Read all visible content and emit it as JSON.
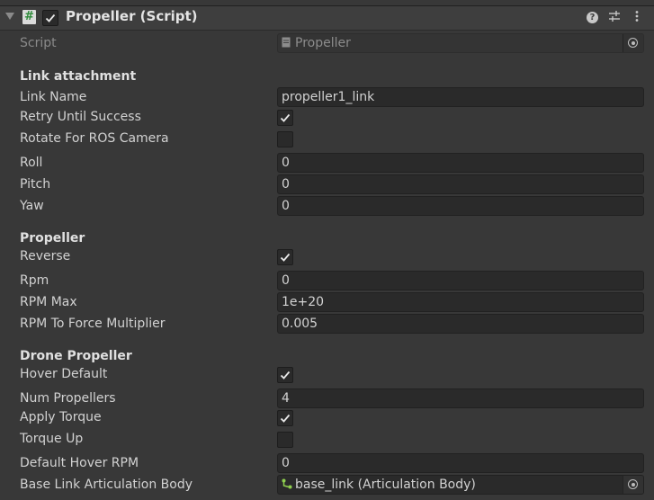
{
  "component": {
    "title": "Propeller (Script)",
    "enabled": true,
    "script_label": "Script",
    "script_value": "Propeller"
  },
  "sections": {
    "link_attachment": {
      "title": "Link attachment",
      "link_name_label": "Link Name",
      "link_name_value": "propeller1_link",
      "retry_label": "Retry Until Success",
      "retry_checked": true,
      "rotate_label": "Rotate For ROS Camera",
      "rotate_checked": false,
      "roll_label": "Roll",
      "roll_value": "0",
      "pitch_label": "Pitch",
      "pitch_value": "0",
      "yaw_label": "Yaw",
      "yaw_value": "0"
    },
    "propeller": {
      "title": "Propeller",
      "reverse_label": "Reverse",
      "reverse_checked": true,
      "rpm_label": "Rpm",
      "rpm_value": "0",
      "rpm_max_label": "RPM Max",
      "rpm_max_value": "1e+20",
      "rpm_force_label": "RPM To Force Multiplier",
      "rpm_force_value": "0.005"
    },
    "drone_propeller": {
      "title": "Drone Propeller",
      "hover_default_label": "Hover Default",
      "hover_default_checked": true,
      "num_props_label": "Num Propellers",
      "num_props_value": "4",
      "apply_torque_label": "Apply Torque",
      "apply_torque_checked": true,
      "torque_up_label": "Torque Up",
      "torque_up_checked": false,
      "default_hover_rpm_label": "Default Hover RPM",
      "default_hover_rpm_value": "0",
      "base_link_label": "Base Link Articulation Body",
      "base_link_value": "base_link (Articulation Body)"
    }
  },
  "icons": {
    "foldout": "triangle-down-icon",
    "script": "csharp-script-icon",
    "help": "help-icon",
    "presets": "sliders-icon",
    "menu": "kebab-menu-icon",
    "object_picker": "object-picker-icon",
    "articulation_body": "articulation-body-icon"
  },
  "colors": {
    "background": "#383838",
    "header": "#3e3e3e",
    "field": "#2a2a2a",
    "text": "#d2d2d2",
    "script_icon_green": "#2e8b3a",
    "articulation_icon_green": "#8fcf4f"
  }
}
